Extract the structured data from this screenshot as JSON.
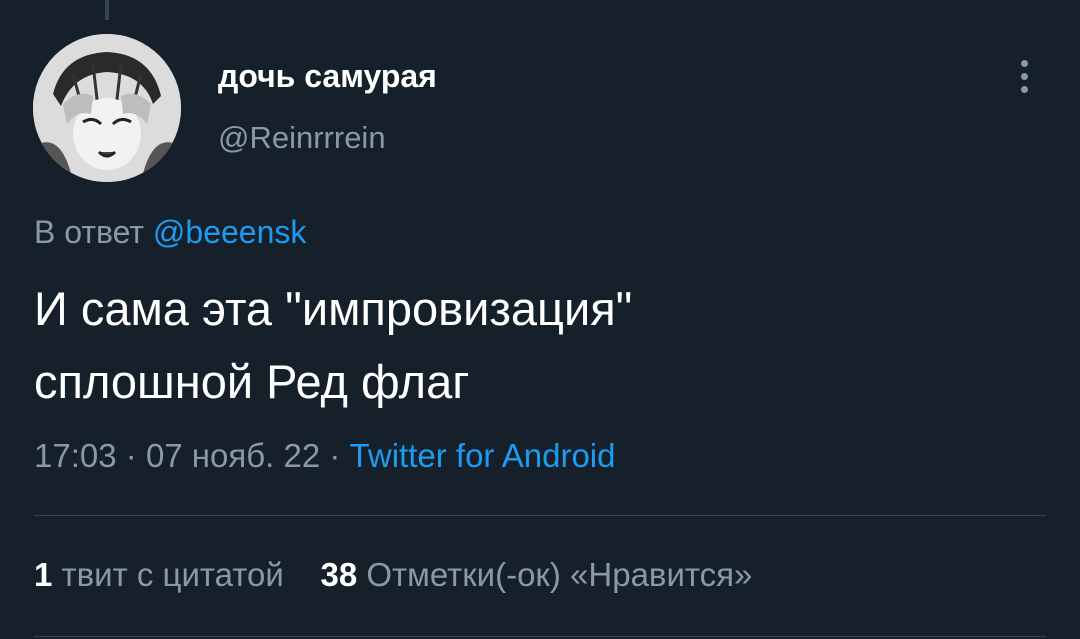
{
  "author": {
    "display_name": "дочь самурая",
    "handle": "@Reinrrrein",
    "avatar_icon": "anime-avatar"
  },
  "more_icon": "vertical-dots-icon",
  "reply": {
    "prefix": "В ответ",
    "mention": "@beeensk"
  },
  "tweet": {
    "lines": [
      "И сама эта \"импровизация\"",
      "сплошной Ред флаг"
    ]
  },
  "meta": {
    "time": "17:03",
    "separator": "·",
    "date": "07 нояб. 22",
    "source": "Twitter for Android"
  },
  "stats": {
    "quotes_count": "1",
    "quotes_label": "твит с цитатой",
    "likes_count": "38",
    "likes_label": "Отметки(-ок) «Нравится»"
  },
  "colors": {
    "background": "#15202b",
    "text_primary": "#ffffff",
    "text_secondary": "#8b98a5",
    "accent": "#1d9bf0",
    "divider": "#38444d"
  }
}
